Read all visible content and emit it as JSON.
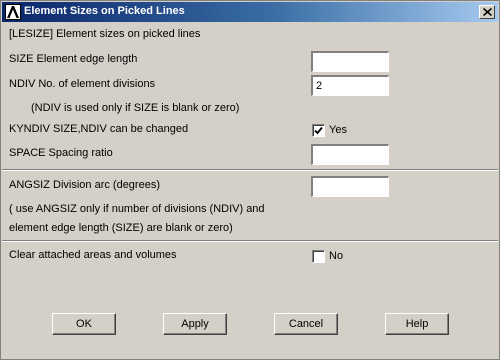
{
  "window": {
    "title": "Element Sizes on Picked Lines",
    "command_label": "[LESIZE]  Element sizes on picked lines"
  },
  "fields": {
    "size": {
      "label": "SIZE   Element edge length",
      "value": ""
    },
    "ndiv": {
      "label": "NDIV   No. of element divisions",
      "value": "2"
    },
    "ndiv_note": "(NDIV is used only if SIZE is blank or zero)",
    "kyndiv": {
      "label": "KYNDIV  SIZE,NDIV can be changed",
      "checked": true,
      "state_label": "Yes"
    },
    "space": {
      "label": "SPACE   Spacing ratio",
      "value": ""
    },
    "angsiz": {
      "label": "ANGSIZ  Division arc (degrees)",
      "value": ""
    },
    "angsiz_note_line1": "( use ANGSIZ only if number of divisions (NDIV) and",
    "angsiz_note_line2": "element edge length (SIZE) are blank or zero)",
    "clear": {
      "label": "Clear attached areas and volumes",
      "checked": false,
      "state_label": "No"
    }
  },
  "buttons": {
    "ok": "OK",
    "apply": "Apply",
    "cancel": "Cancel",
    "help": "Help"
  },
  "icons": {
    "app": "ansys-logo-icon",
    "close": "close-icon",
    "check": "checkmark-icon"
  }
}
